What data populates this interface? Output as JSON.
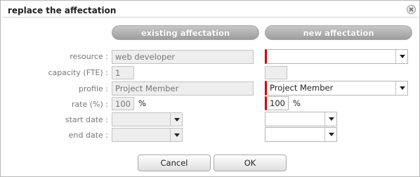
{
  "dialog": {
    "title": "replace the affectation"
  },
  "headers": {
    "existing": "existing affectation",
    "new": "new affectation"
  },
  "labels": {
    "resource": "resource :",
    "capacity": "capacity (FTE) :",
    "profile": "profile :",
    "rate": "rate (%) :",
    "start_date": "start date :",
    "end_date": "end date :"
  },
  "existing": {
    "resource": "web developer",
    "capacity": "1",
    "profile": "Project Member",
    "rate": "100",
    "rate_unit": "%",
    "start_date": "",
    "end_date": ""
  },
  "new": {
    "resource": "",
    "capacity": "",
    "profile": "Project Member",
    "rate": "100",
    "rate_unit": "%",
    "start_date": "",
    "end_date": ""
  },
  "buttons": {
    "cancel": "Cancel",
    "ok": "OK"
  },
  "colors": {
    "required_marker": "#d20000",
    "header_gray": "#b0b0b0"
  }
}
